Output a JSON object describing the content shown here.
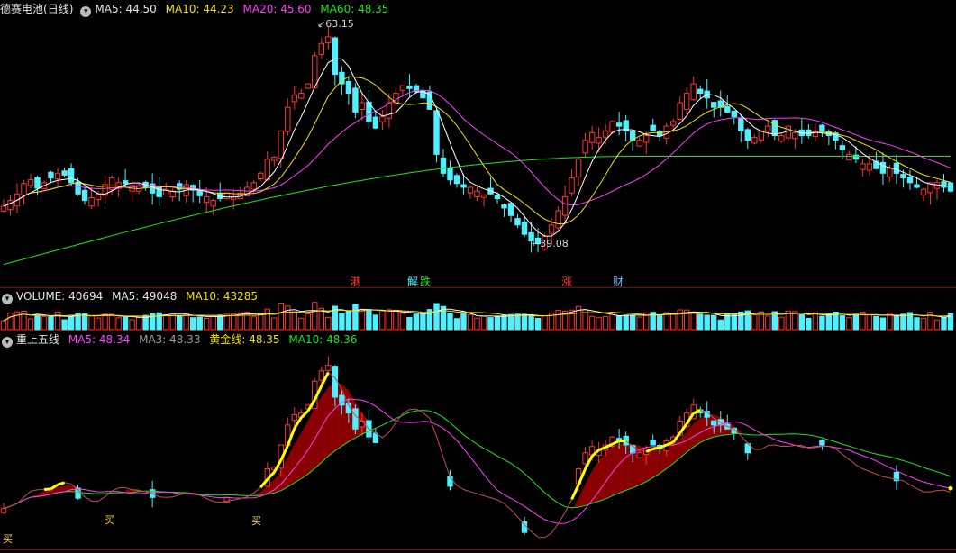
{
  "header_price": {
    "stock_name": "德赛电池",
    "period": "(日线)",
    "ma5": "MA5: 44.50",
    "ma10": "MA10: 44.23",
    "ma20": "MA20: 45.60",
    "ma60": "MA60: 48.35"
  },
  "header_volume": {
    "name": "VOLUME: 40694",
    "ma5": "MA5: 49048",
    "ma10": "MA10: 43285"
  },
  "header_indicator": {
    "name": "重上五线",
    "ma5": "MA5: 48.34",
    "ma3": "MA3: 48.33",
    "gold": "黄金线: 48.35",
    "ma10": "MA10: 48.36"
  },
  "annotations": {
    "high": "63.15",
    "low": "39.08"
  },
  "events": {
    "e1": "港",
    "e2": "解",
    "e3": "跌",
    "e4": "涨",
    "e5": "财"
  },
  "buy_signals": {
    "b1": "买",
    "b2": "买",
    "b3": "买"
  },
  "colors": {
    "up": "#ff3232",
    "down": "#4ff0ff",
    "ma5": "#ffffff",
    "ma10": "#f1e100",
    "ma20": "#ff3bff",
    "ma60": "#19e619",
    "gold": "#ffff00",
    "band": "#8b0000"
  },
  "chart_data": [
    {
      "type": "candlestick",
      "name": "price",
      "high": 63.15,
      "low": 39.08,
      "ma_last": {
        "MA5": 44.5,
        "MA10": 44.23,
        "MA20": 45.6,
        "MA60": 48.35
      },
      "close_path": [
        44.0,
        44.6,
        45.3,
        46.4,
        46.8,
        45.9,
        46.5,
        47.0,
        47.5,
        47.3,
        46.5,
        45.3,
        44.6,
        44.9,
        45.3,
        46.3,
        47.0,
        46.5,
        46.4,
        46.2,
        46.2,
        46.0,
        45.4,
        45.0,
        45.8,
        45.6,
        45.8,
        46.3,
        45.7,
        45.1,
        45.0,
        44.6,
        44.8,
        45.4,
        45.0,
        45.4,
        46.0,
        46.5,
        47.5,
        49.0,
        49.2,
        52.0,
        54.5,
        55.8,
        56.0,
        57.0,
        60.0,
        61.3,
        62.0,
        58.0,
        57.0,
        56.0,
        54.0,
        55.0,
        53.0,
        52.3,
        53.5,
        55.0,
        56.0,
        56.8,
        56.5,
        56.2,
        55.5,
        54.3,
        49.5,
        47.5,
        46.8,
        46.4,
        46.0,
        46.0,
        45.6,
        45.2,
        45.3,
        44.8,
        43.8,
        43.0,
        42.0,
        41.0,
        40.3,
        40.0,
        40.8,
        42.0,
        43.5,
        45.0,
        47.0,
        49.0,
        51.0,
        51.8,
        51.3,
        52.0,
        53.0,
        52.5,
        52.0,
        51.0,
        51.0,
        51.5,
        52.0,
        51.5,
        52.5,
        53.0,
        55.0,
        56.0,
        57.0,
        56.0,
        55.5,
        54.5,
        54.5,
        54.0,
        53.5,
        52.0,
        51.0,
        51.3,
        52.0,
        52.5,
        51.5,
        51.5,
        52.5,
        51.8,
        51.5,
        51.5,
        52.0,
        52.0,
        51.5,
        51.0,
        50.0,
        49.5,
        49.0,
        48.5,
        48.5,
        48.0,
        47.5,
        48.0,
        47.5,
        47.0,
        46.5,
        46.0,
        45.8,
        46.5,
        46.5,
        46.0,
        45.6
      ]
    },
    {
      "type": "bar",
      "name": "volume",
      "last": 40694,
      "ma_last": {
        "MA5": 49048,
        "MA10": 43285
      }
    },
    {
      "type": "line",
      "name": "重上五线",
      "last": {
        "MA5": 48.34,
        "MA3": 48.33,
        "黄金线": 48.35,
        "MA10": 48.36
      }
    }
  ]
}
